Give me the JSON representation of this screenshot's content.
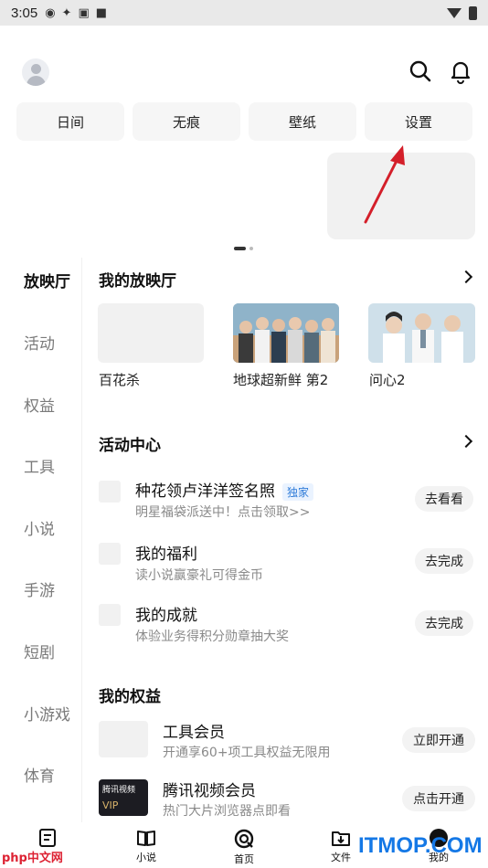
{
  "status_bar": {
    "time": "3:05"
  },
  "tools": [
    "日间",
    "无痕",
    "壁纸",
    "设置"
  ],
  "side_nav": [
    "放映厅",
    "活动",
    "权益",
    "工具",
    "小说",
    "手游",
    "短剧",
    "小游戏",
    "体育"
  ],
  "theater": {
    "title": "我的放映厅",
    "items": [
      {
        "caption": "百花杀"
      },
      {
        "caption": "地球超新鲜 第2"
      },
      {
        "caption": "问心2"
      }
    ]
  },
  "activity": {
    "title": "活动中心",
    "items": [
      {
        "title": "种花领卢洋洋签名照",
        "badge": "独家",
        "subtitle": "明星福袋派送中！点击领取>>",
        "button": "去看看"
      },
      {
        "title": "我的福利",
        "badge": "",
        "subtitle": "读小说赢豪礼可得金币",
        "button": "去完成"
      },
      {
        "title": "我的成就",
        "badge": "",
        "subtitle": "体验业务得积分勋章抽大奖",
        "button": "去完成"
      }
    ]
  },
  "perks": {
    "title": "我的权益",
    "items": [
      {
        "title": "工具会员",
        "subtitle": "开通享60+项工具权益无限用",
        "button": "立即开通",
        "logo_text": ""
      },
      {
        "title": "腾讯视频会员",
        "subtitle": "热门大片浏览器点即看",
        "button": "点击开通",
        "logo_text": "腾讯视频",
        "logo_sub": "VIP"
      }
    ]
  },
  "bottom_nav": [
    "小说",
    "首页",
    "文件",
    "我的"
  ],
  "watermarks": {
    "left": "php中文网",
    "right": "ITMOP.COM"
  },
  "colors": {
    "accent_arrow": "#d41f2a",
    "badge_blue": "#2e7bd8",
    "watermark_blue": "#1478e6"
  }
}
